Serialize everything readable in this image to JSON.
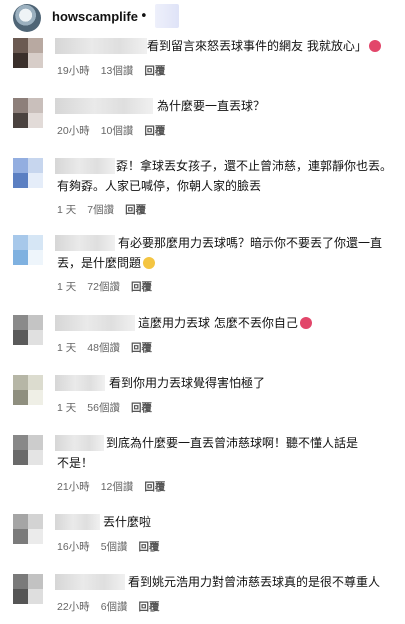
{
  "header": {
    "username": "howscamplife",
    "separator": "•"
  },
  "reply_label": "回覆",
  "comments": [
    {
      "text": "看到留言來怒丟球事件的網友 我就放心」",
      "emoji": "devil",
      "time": "19小時",
      "likes": "13個讚"
    },
    {
      "text": "為什麼要一直丟球？",
      "time": "20小時",
      "likes": "10個讚"
    },
    {
      "text": "孬！拿球丟女孩子，還不止曾沛慈，連郭靜你也丟。\n有夠孬。人家已喊停，你朝人家的臉丟",
      "time": "1 天",
      "likes": "7個讚"
    },
    {
      "text": "有必要那麼用力丟球嗎？暗示你不要丟了你還一直\n丟，是什麼問題",
      "emoji": "smile",
      "time": "1 天",
      "likes": "72個讚"
    },
    {
      "text": "這麼用力丟球 怎麼不丟你自己",
      "emoji": "devil",
      "time": "1 天",
      "likes": "48個讚"
    },
    {
      "text": "看到你用力丟球覺得害怕極了",
      "time": "1 天",
      "likes": "56個讚"
    },
    {
      "text": "到底為什麼要一直丟曾沛慈球啊！聽不懂人話是\n不是！",
      "time": "21小時",
      "likes": "12個讚"
    },
    {
      "text": "丟什麼啦",
      "time": "16小時",
      "likes": "5個讚"
    },
    {
      "text": "看到姚元浩用力對曾沛慈丟球真的是很不尊重人",
      "time": "22小時",
      "likes": "6個讚"
    }
  ],
  "avatar_colors": [
    [
      "#6b5a52",
      "#b8a9a1",
      "#3a2f2b",
      "#d7cdc8"
    ],
    [
      "#8d7f7a",
      "#c9bfbb",
      "#4a423f",
      "#e2dbd8"
    ],
    [
      "#93aee0",
      "#c7d6ee",
      "#5b7fc2",
      "#e5edf9"
    ],
    [
      "#a7c8ea",
      "#d6e6f5",
      "#7fb1e0",
      "#eef5fb"
    ],
    [
      "#8a8a8a",
      "#c4c4c4",
      "#5a5a5a",
      "#e0e0e0"
    ],
    [
      "#b6b6a6",
      "#dcdccf",
      "#8f8f7f",
      "#efefe6"
    ],
    [
      "#888888",
      "#cccccc",
      "#6a6a6a",
      "#e4e4e4"
    ],
    [
      "#a5a5a5",
      "#d3d3d3",
      "#7b7b7b",
      "#ebebeb"
    ],
    [
      "#7a7a7a",
      "#c2c2c2",
      "#555555",
      "#dedede"
    ]
  ]
}
